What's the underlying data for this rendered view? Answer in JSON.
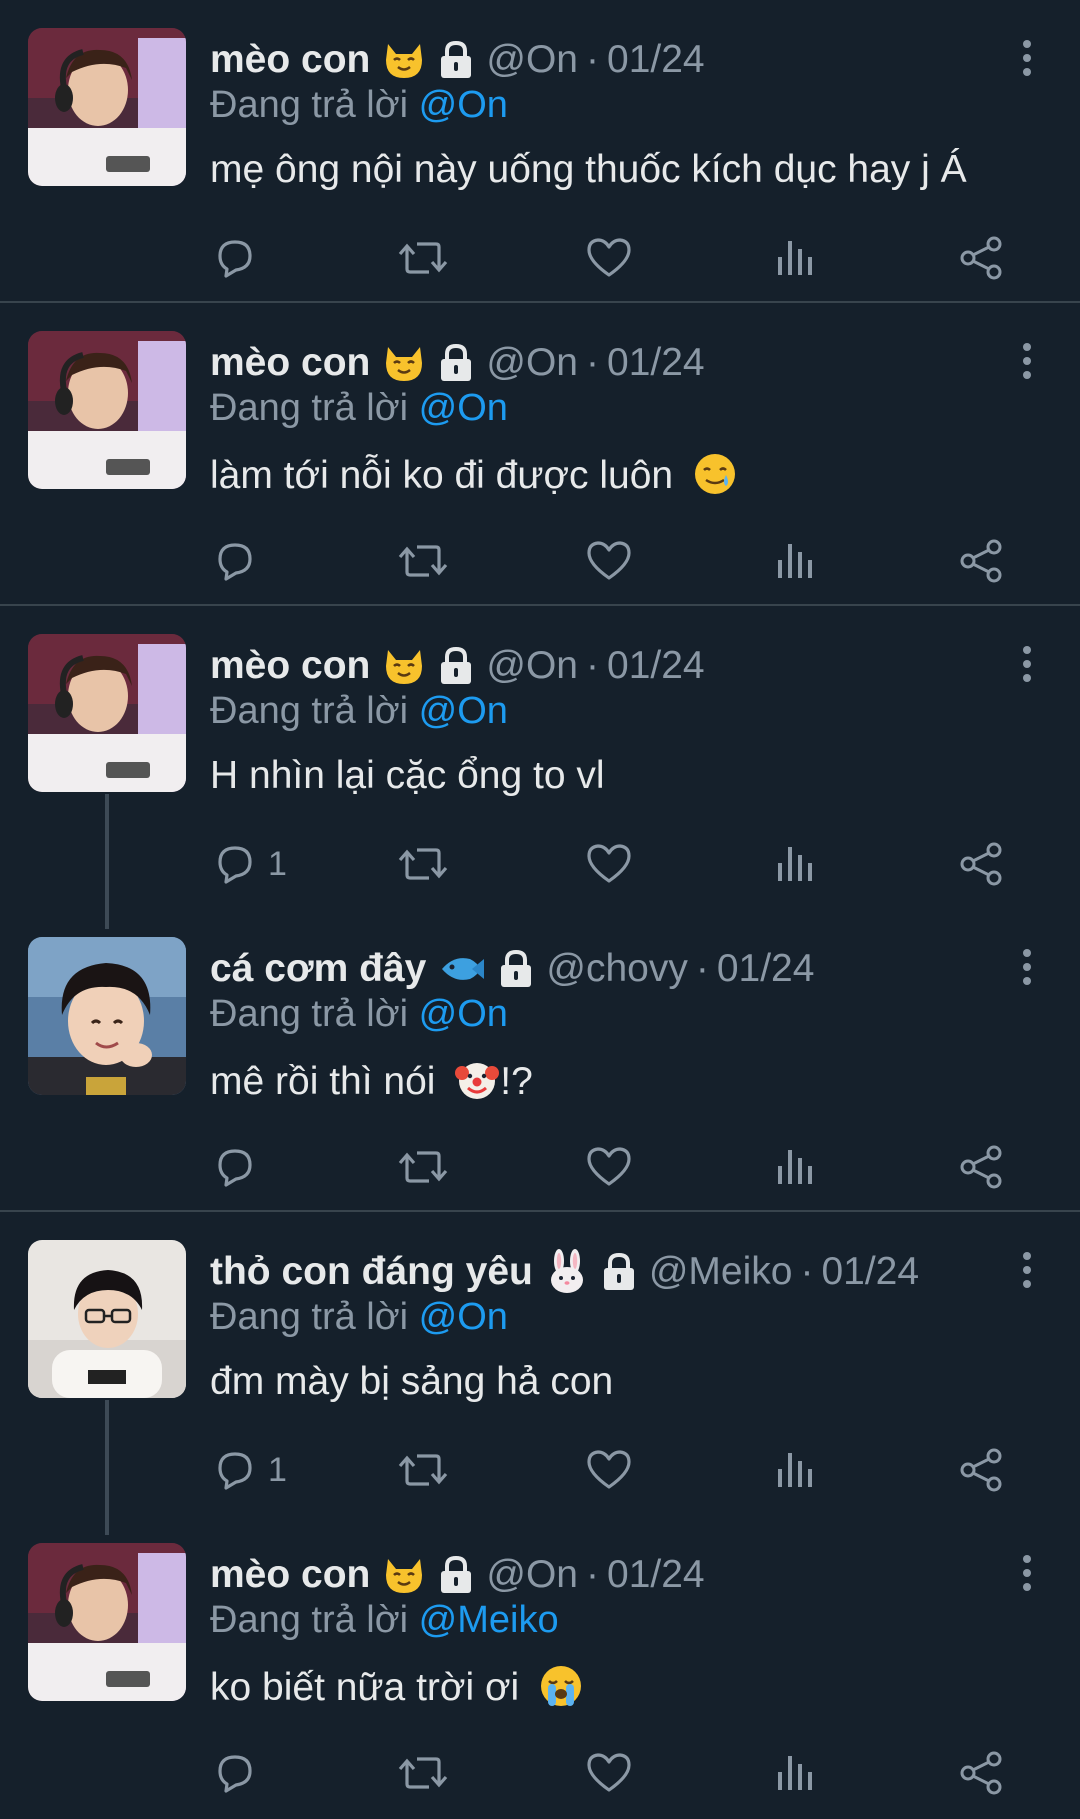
{
  "tweets": [
    {
      "avatar": "meo-con-avatar",
      "name": "mèo con",
      "emoji": "cat-face-emoji",
      "handle": "@On",
      "dot": "·",
      "date": "01/24",
      "reply_prefix": "Đang trả lời",
      "reply_to": "@On",
      "text": "mẹ ông nội này uống thuốc kích dục hay j Á",
      "content_emoji": "",
      "reply_count": "",
      "separator": true,
      "thread_line": false
    },
    {
      "avatar": "meo-con-avatar",
      "name": "mèo con",
      "emoji": "cat-face-emoji",
      "handle": "@On",
      "dot": "·",
      "date": "01/24",
      "reply_prefix": "Đang trả lời",
      "reply_to": "@On",
      "text": "làm tới nỗi ko đi được luôn",
      "content_emoji": "smiling-face-with-tear-emoji",
      "reply_count": "",
      "separator": true,
      "thread_line": false
    },
    {
      "avatar": "meo-con-avatar",
      "name": "mèo con",
      "emoji": "cat-face-emoji",
      "handle": "@On",
      "dot": "·",
      "date": "01/24",
      "reply_prefix": "Đang trả lời",
      "reply_to": "@On",
      "text": "H nhìn lại cặc ổng to vl",
      "content_emoji": "",
      "reply_count": "1",
      "separator": false,
      "thread_line": true
    },
    {
      "avatar": "chovy-avatar",
      "name": "cá cơm đây",
      "emoji": "fish-emoji",
      "handle": "@chovy",
      "dot": "·",
      "date": "01/24",
      "reply_prefix": "Đang trả lời",
      "reply_to": "@On",
      "text": "mê rồi thì nói",
      "content_emoji": "clown-face-emoji",
      "text_after": "!?",
      "reply_count": "",
      "separator": true,
      "thread_line": false
    },
    {
      "avatar": "meiko-avatar",
      "name": "thỏ con đáng yêu",
      "emoji": "rabbit-face-emoji",
      "handle": "@Meiko",
      "dot": "·",
      "date": "01/24",
      "reply_prefix": "Đang trả lời",
      "reply_to": "@On",
      "text": "đm mày bị sảng hả con",
      "content_emoji": "",
      "reply_count": "1",
      "separator": false,
      "thread_line": true
    },
    {
      "avatar": "meo-con-avatar",
      "name": "mèo con",
      "emoji": "cat-face-emoji",
      "handle": "@On",
      "dot": "·",
      "date": "01/24",
      "reply_prefix": "Đang trả lời",
      "reply_to": "@Meiko",
      "text": "ko biết nữa trời ơi",
      "content_emoji": "loudly-crying-face-emoji",
      "reply_count": "",
      "separator": false,
      "thread_line": false
    }
  ],
  "icons": {
    "reply": "reply-icon",
    "retweet": "retweet-icon",
    "like": "heart-icon",
    "views": "views-icon",
    "share": "share-icon",
    "more": "more-vertical-icon",
    "lock": "lock-icon"
  },
  "colors": {
    "background": "#15202b",
    "text": "#e7e9ea",
    "muted": "#8b98a5",
    "accent": "#1d9bf0",
    "divider": "#38444d"
  }
}
